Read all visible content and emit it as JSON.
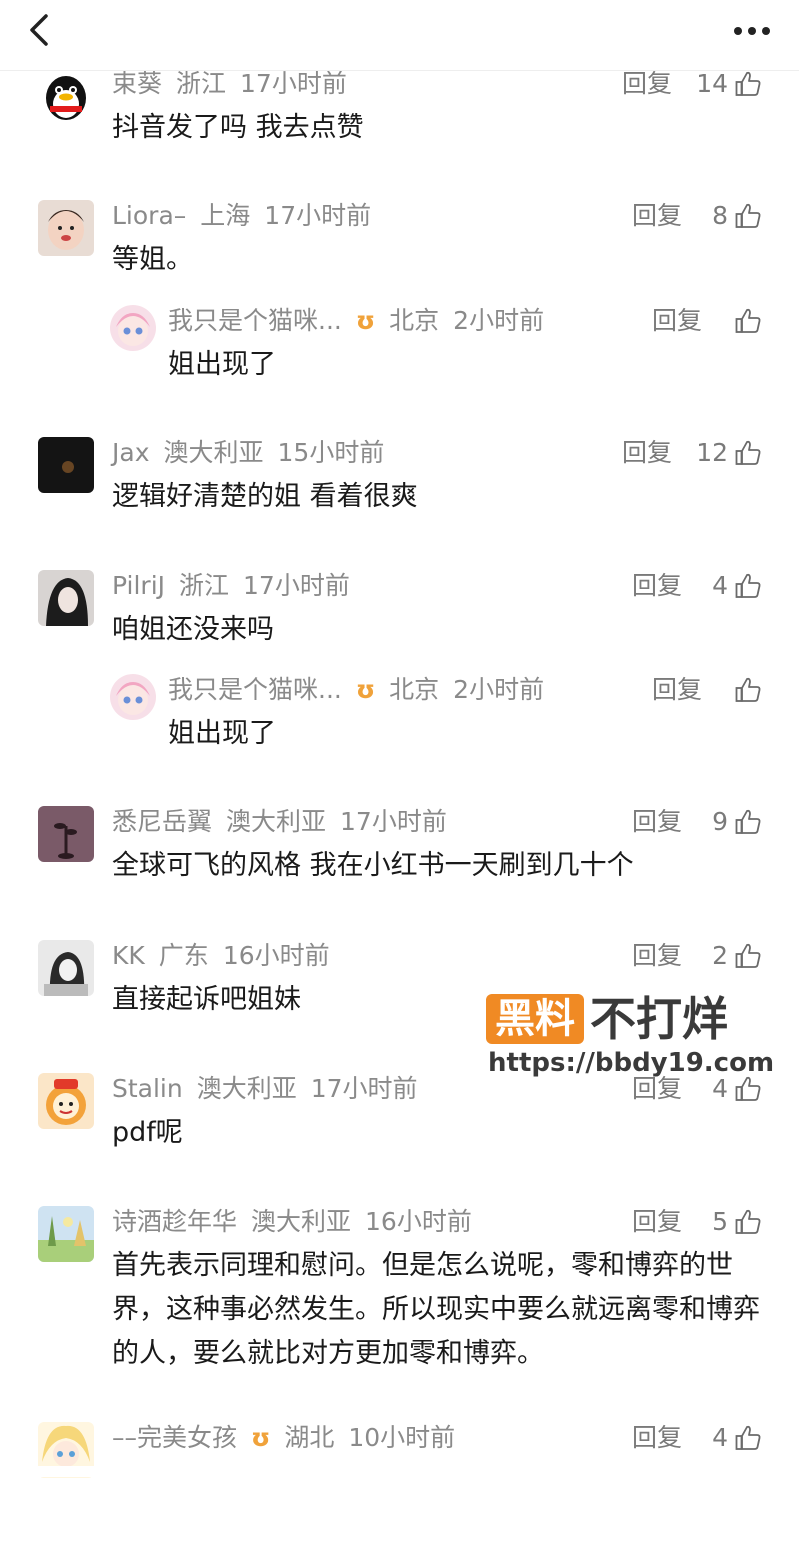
{
  "header": {
    "back_icon": "chevron-left-icon",
    "more_icon": "more-dots-icon"
  },
  "reply_label": "回复",
  "comments": [
    {
      "user": "束葵",
      "location": "浙江",
      "time": "17小时前",
      "text": "抖音发了吗 我去点赞",
      "likes": "14",
      "avatar": "penguin"
    },
    {
      "user": "Liora–",
      "location": "上海",
      "time": "17小时前",
      "text": "等姐。",
      "likes": "8",
      "avatar": "baby"
    },
    {
      "user": "我只是个猫咪...",
      "location": "北京",
      "time": "2小时前",
      "text": "姐出现了",
      "likes": "",
      "avatar": "anime-pink",
      "reply": true,
      "badge": "ʊ"
    },
    {
      "user": "Jax",
      "location": "澳大利亚",
      "time": "15小时前",
      "text": "逻辑好清楚的姐 看着很爽",
      "likes": "12",
      "avatar": "dark"
    },
    {
      "user": "PilriJ",
      "location": "浙江",
      "time": "17小时前",
      "text": "咱姐还没来吗",
      "likes": "4",
      "avatar": "girl"
    },
    {
      "user": "我只是个猫咪...",
      "location": "北京",
      "time": "2小时前",
      "text": "姐出现了",
      "likes": "",
      "avatar": "anime-pink",
      "reply": true,
      "badge": "ʊ"
    },
    {
      "user": "悉尼岳翼",
      "location": "澳大利亚",
      "time": "17小时前",
      "text": "全球可飞的风格 我在小红书一天刷到几十个",
      "likes": "9",
      "avatar": "plant"
    },
    {
      "user": "KK",
      "location": "广东",
      "time": "16小时前",
      "text": "直接起诉吧姐妹",
      "likes": "2",
      "avatar": "bw"
    },
    {
      "user": "Stalin",
      "location": "澳大利亚",
      "time": "17小时前",
      "text": "pdf呢",
      "likes": "4",
      "avatar": "lion"
    },
    {
      "user": "诗酒趁年华",
      "location": "澳大利亚",
      "time": "16小时前",
      "text": "首先表示同理和慰问。但是怎么说呢，零和博弈的世界，这种事必然发生。所以现实中要么就远离零和博弈的人，要么就比对方更加零和博弈。",
      "likes": "5",
      "avatar": "landscape"
    },
    {
      "user": "––完美女孩",
      "location": "湖北",
      "time": "10小时前",
      "text": "",
      "likes": "4",
      "avatar": "anime-blonde",
      "badge": "ʊ"
    }
  ],
  "watermark": {
    "badge": "黑料",
    "text": "不打烊",
    "url": "https://bbdy19.com"
  }
}
